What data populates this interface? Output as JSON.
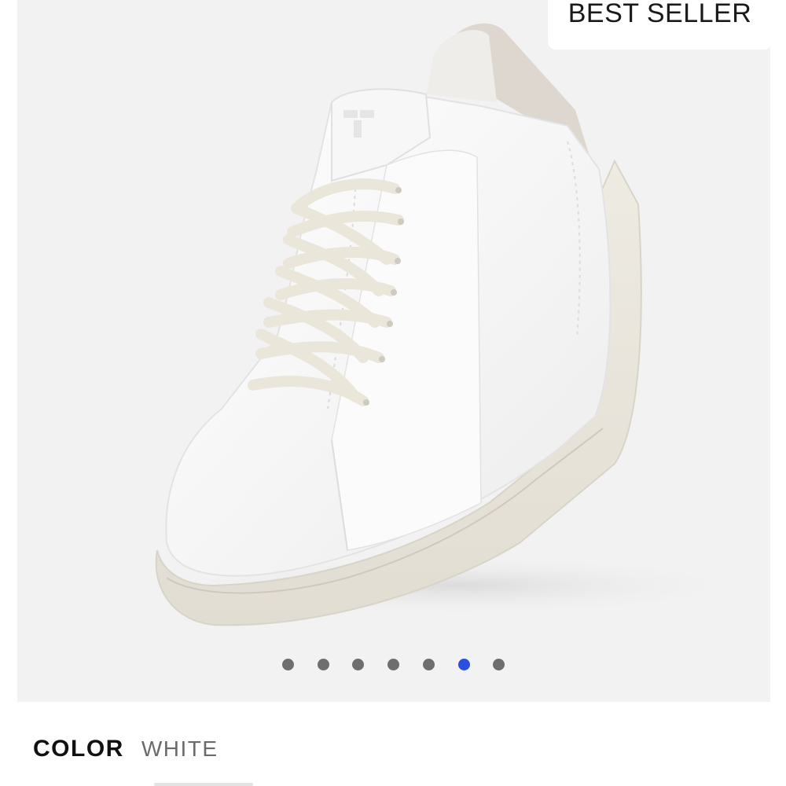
{
  "badge": {
    "label": "BEST SELLER"
  },
  "product": {
    "image_subject": "white low-top leather sneaker with cream laces and cream sole"
  },
  "carousel": {
    "total": 7,
    "active_index": 5,
    "active_color": "#2b4fe0",
    "inactive_color": "#6e6e6e"
  },
  "color_selector": {
    "label": "COLOR",
    "value": "WHITE"
  }
}
